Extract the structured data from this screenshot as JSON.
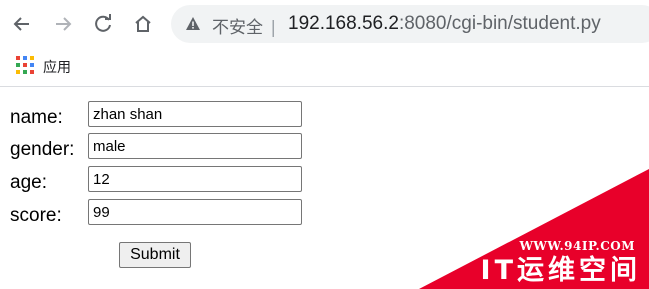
{
  "browser": {
    "back_icon": "arrow-left-icon",
    "forward_icon": "arrow-right-icon",
    "reload_icon": "reload-icon",
    "home_icon": "home-icon",
    "security_icon": "warning-triangle-icon",
    "security_label": "不安全",
    "url_host": "192.168.56.2",
    "url_rest": ":8080/cgi-bin/student.py",
    "separator": "|"
  },
  "bookmarks": {
    "apps_icon": "apps-grid-icon",
    "apps_label": "应用"
  },
  "form": {
    "fields": [
      {
        "label": "name:",
        "value": "zhan shan"
      },
      {
        "label": "gender:",
        "value": "male"
      },
      {
        "label": "age:",
        "value": "12"
      },
      {
        "label": "score:",
        "value": "99"
      }
    ],
    "submit_label": "Submit"
  },
  "watermark": {
    "url": "WWW.94IP.COM",
    "brand": "IT运维空间",
    "color": "#e8002a"
  }
}
